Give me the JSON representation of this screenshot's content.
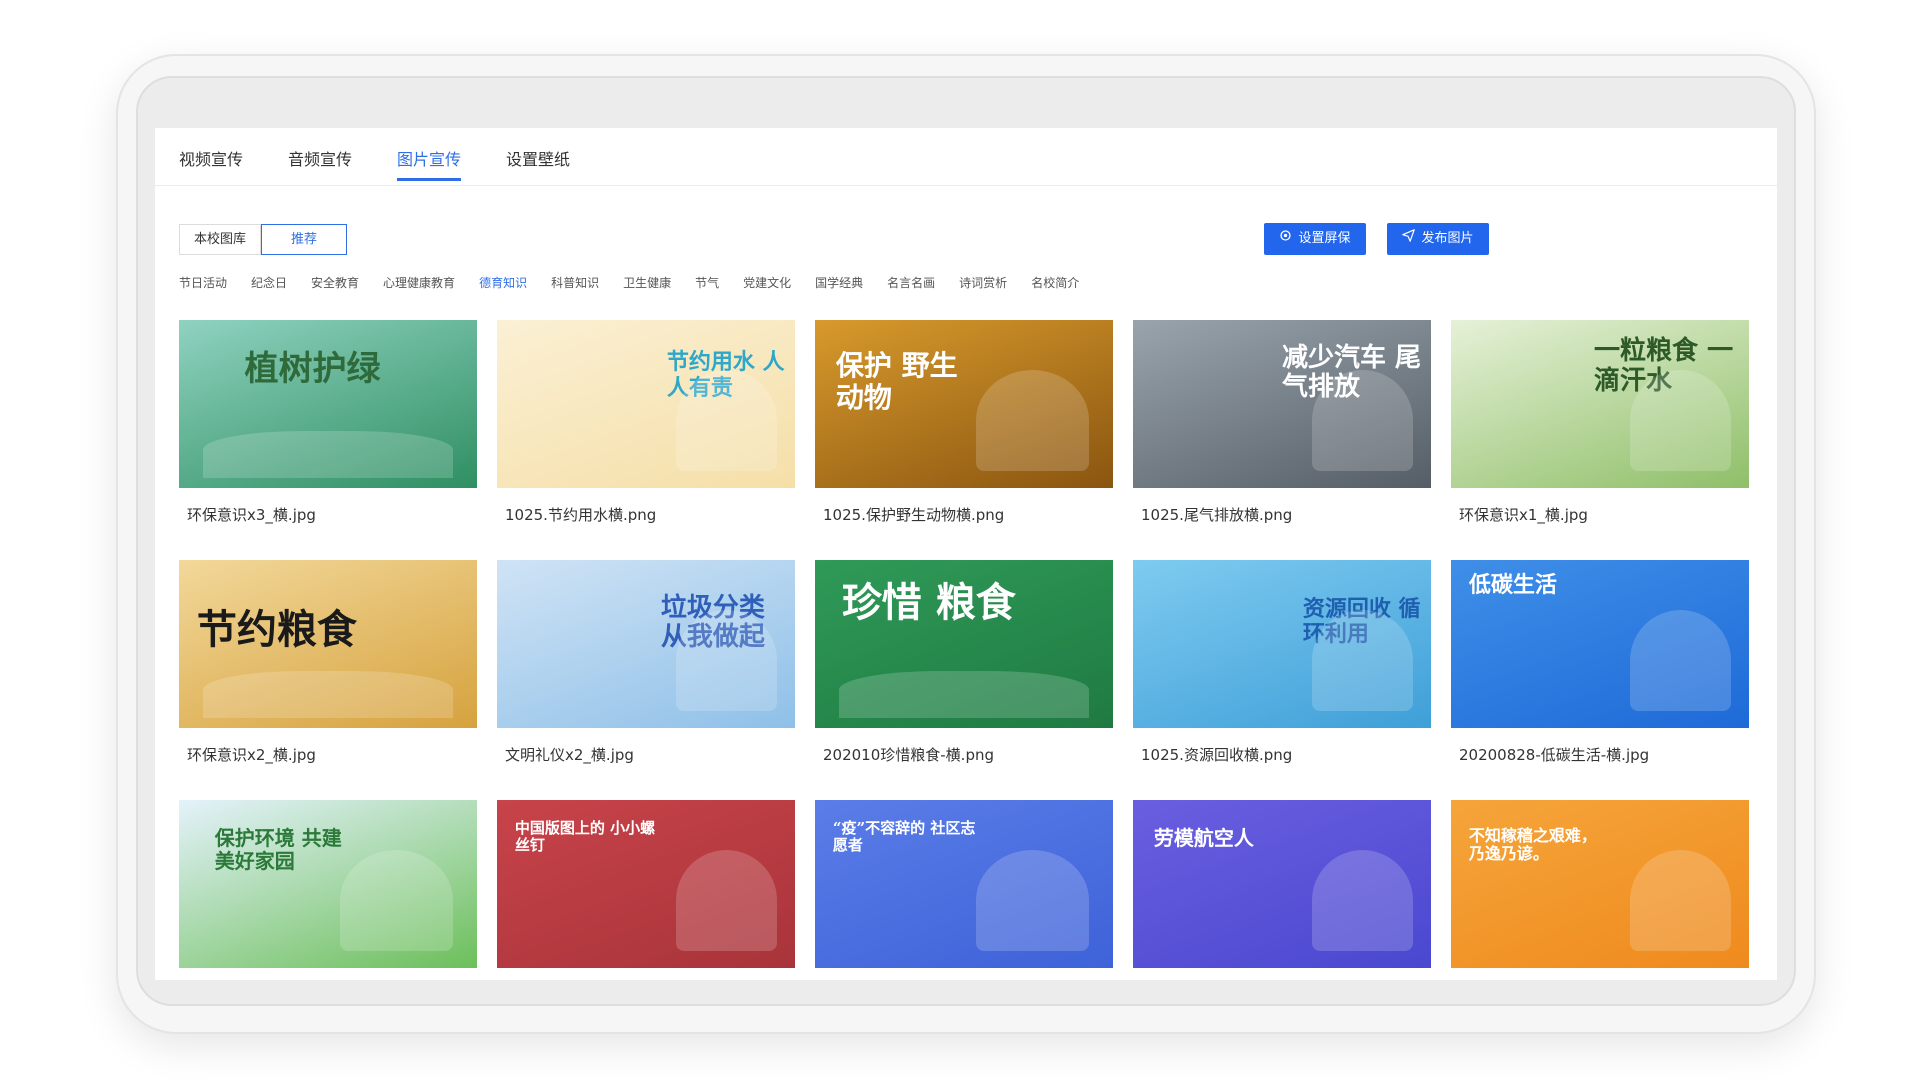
{
  "tabs": [
    {
      "label": "视频宣传",
      "active": false
    },
    {
      "label": "音频宣传",
      "active": false
    },
    {
      "label": "图片宣传",
      "active": true
    },
    {
      "label": "设置壁纸",
      "active": false
    }
  ],
  "library": {
    "local": "本校图库",
    "recommended": "推荐"
  },
  "actions": {
    "screensaver": "设置屏保",
    "publish": "发布图片"
  },
  "categories": [
    {
      "label": "节日活动",
      "active": false
    },
    {
      "label": "纪念日",
      "active": false
    },
    {
      "label": "安全教育",
      "active": false
    },
    {
      "label": "心理健康教育",
      "active": false
    },
    {
      "label": "德育知识",
      "active": true
    },
    {
      "label": "科普知识",
      "active": false
    },
    {
      "label": "卫生健康",
      "active": false
    },
    {
      "label": "节气",
      "active": false
    },
    {
      "label": "党建文化",
      "active": false
    },
    {
      "label": "国学经典",
      "active": false
    },
    {
      "label": "名言名画",
      "active": false
    },
    {
      "label": "诗词赏析",
      "active": false
    },
    {
      "label": "名校简介",
      "active": false
    }
  ],
  "colors": {
    "accent": "#2f6fe6",
    "button": "#2166ec"
  },
  "images": [
    {
      "filename": "环保意识x3_横.jpg",
      "title": "植树护绿",
      "bg": "#8fd2c0",
      "bg2": "#2f8f62",
      "title_color": "#2f6a3a"
    },
    {
      "filename": "1025.节约用水横.png",
      "title": "节约用水 人人有责",
      "bg": "#fbf0d4",
      "bg2": "#f5dfa8",
      "title_color": "#2fa7c8"
    },
    {
      "filename": "1025.保护野生动物横.png",
      "title": "保护 野生动物",
      "bg": "#d89a2c",
      "bg2": "#8a5510",
      "title_color": "#ffffff"
    },
    {
      "filename": "1025.尾气排放横.png",
      "title": "减少汽车 尾气排放",
      "bg": "#9aa4ad",
      "bg2": "#555e66",
      "title_color": "#ffffff"
    },
    {
      "filename": "环保意识x1_横.jpg",
      "title": "一粒粮食 一滴汗水",
      "bg": "#e6f1d8",
      "bg2": "#8fbf68",
      "title_color": "#2e5a2a"
    },
    {
      "filename": "环保意识x2_横.jpg",
      "title": "节约粮食",
      "bg": "#f2d89a",
      "bg2": "#d6a23e",
      "title_color": "#1a1a1a"
    },
    {
      "filename": "文明礼仪x2_横.jpg",
      "title": "垃圾分类 从我做起",
      "bg": "#cfe3f5",
      "bg2": "#8fc0e8",
      "title_color": "#2f5fb8"
    },
    {
      "filename": "202010珍惜粮食-横.png",
      "title": "珍惜 粮食",
      "bg": "#2f9a58",
      "bg2": "#1f7a42",
      "title_color": "#ffffff"
    },
    {
      "filename": "1025.资源回收横.png",
      "title": "资源回收 循环利用",
      "bg": "#7ecbf0",
      "bg2": "#3f9fd8",
      "title_color": "#1f5fb0"
    },
    {
      "filename": "20200828-低碳生活-横.jpg",
      "title": "低碳生活",
      "bg": "#3f8fe8",
      "bg2": "#1e6ad8",
      "title_color": "#ffffff"
    },
    {
      "filename": "",
      "title": "保护环境 共建美好家园",
      "bg": "#e4f2fb",
      "bg2": "#6cbf5a",
      "title_color": "#2b7a3a"
    },
    {
      "filename": "",
      "title": "中国版图上的 小小螺丝钉",
      "bg": "#c8434a",
      "bg2": "#a8343a",
      "title_color": "#ffffff"
    },
    {
      "filename": "",
      "title": "“疫”不容辞的 社区志愿者",
      "bg": "#5a7de8",
      "bg2": "#3e62d8",
      "title_color": "#ffffff"
    },
    {
      "filename": "",
      "title": "劳模航空人",
      "bg": "#6a5ee0",
      "bg2": "#4a48d0",
      "title_color": "#ffffff"
    },
    {
      "filename": "",
      "title": "不知稼穑之艰难， 乃逸乃谚。",
      "bg": "#f5a53a",
      "bg2": "#ef8a1e",
      "title_color": "#ffffff"
    }
  ]
}
